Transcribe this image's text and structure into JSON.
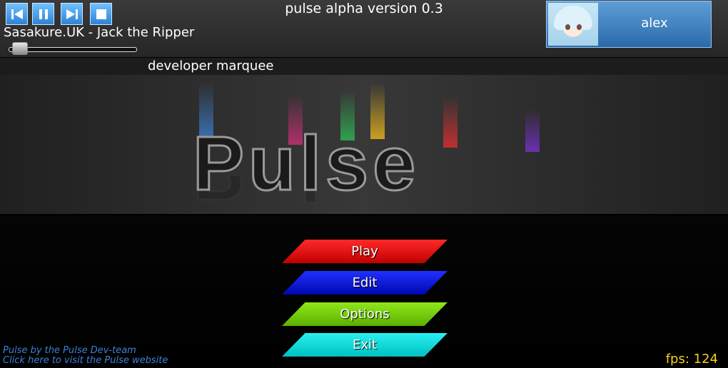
{
  "window": {
    "title": "pulse alpha version 0.3"
  },
  "player": {
    "now_playing": "Sasakure.UK - Jack the Ripper",
    "controls": [
      "previous-icon",
      "pause-icon",
      "next-icon",
      "stop-icon"
    ],
    "progress": 0.05
  },
  "user": {
    "name": "alex"
  },
  "marquee": {
    "text": "developer marquee"
  },
  "banner": {
    "logo": "Pulse",
    "beam_colors": [
      "#3a6fb0",
      "#b0306a",
      "#30a050",
      "#c9a020",
      "#c03030",
      "#6a30b0"
    ]
  },
  "menu": {
    "play": "Play",
    "edit": "Edit",
    "options": "Options",
    "exit": "Exit",
    "colors": {
      "play": "#e00000",
      "edit": "#0010d8",
      "options": "#74d400",
      "exit": "#00dede"
    }
  },
  "footer": {
    "credit_line1": "Pulse by the Pulse Dev-team",
    "credit_line2": "Click here to visit the Pulse website",
    "fps": "fps: 124"
  }
}
